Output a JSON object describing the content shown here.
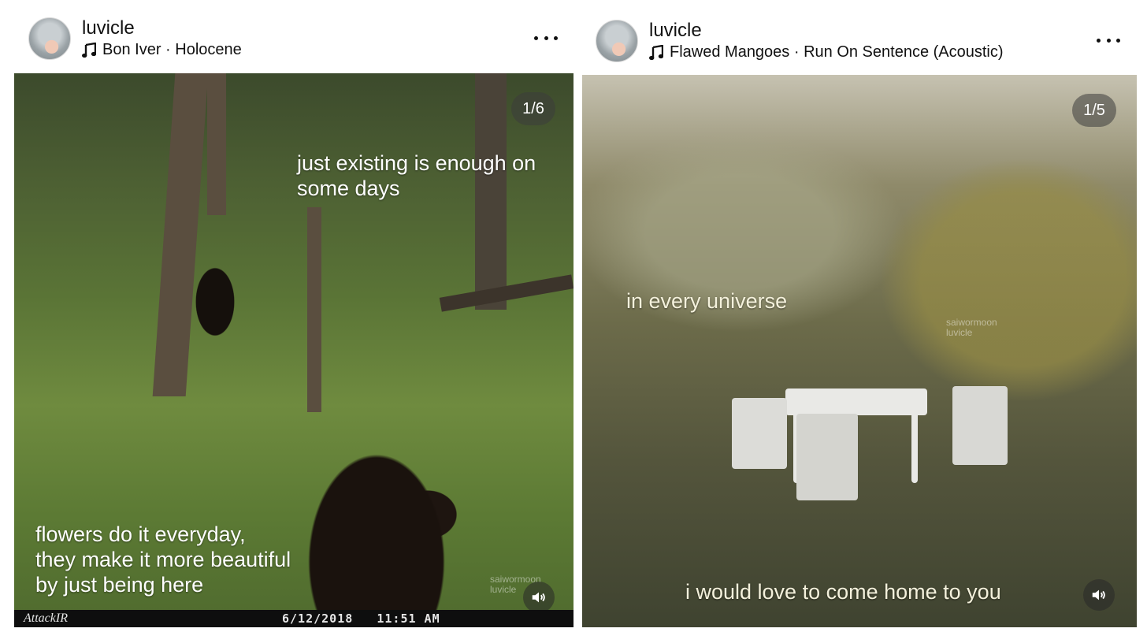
{
  "posts": [
    {
      "username": "luvicle",
      "song": "Bon Iver · Holocene",
      "counter": "1/6",
      "caption_top": "just existing is enough on\nsome days",
      "caption_bottom": "flowers do it everyday,\nthey make it more beautiful\nby just being here",
      "camera_brand": "AttackIR",
      "date": "6/12/2018",
      "time": "11:51 AM",
      "watermark": "saiwormoon\nluvicle"
    },
    {
      "username": "luvicle",
      "song": "Flawed Mangoes · Run On Sentence (Acoustic)",
      "counter": "1/5",
      "caption_top": "in every universe",
      "caption_bottom": "i would love to come home to you",
      "watermark": "saiwormoon\nluvicle"
    }
  ],
  "icons": {
    "music": "music-note-icon",
    "more": "more-options-icon",
    "sound": "speaker-icon"
  },
  "colors": {
    "text": "#111111",
    "overlay_text": "#ffffff",
    "counter_bg": "rgba(60,60,60,0.55)"
  }
}
